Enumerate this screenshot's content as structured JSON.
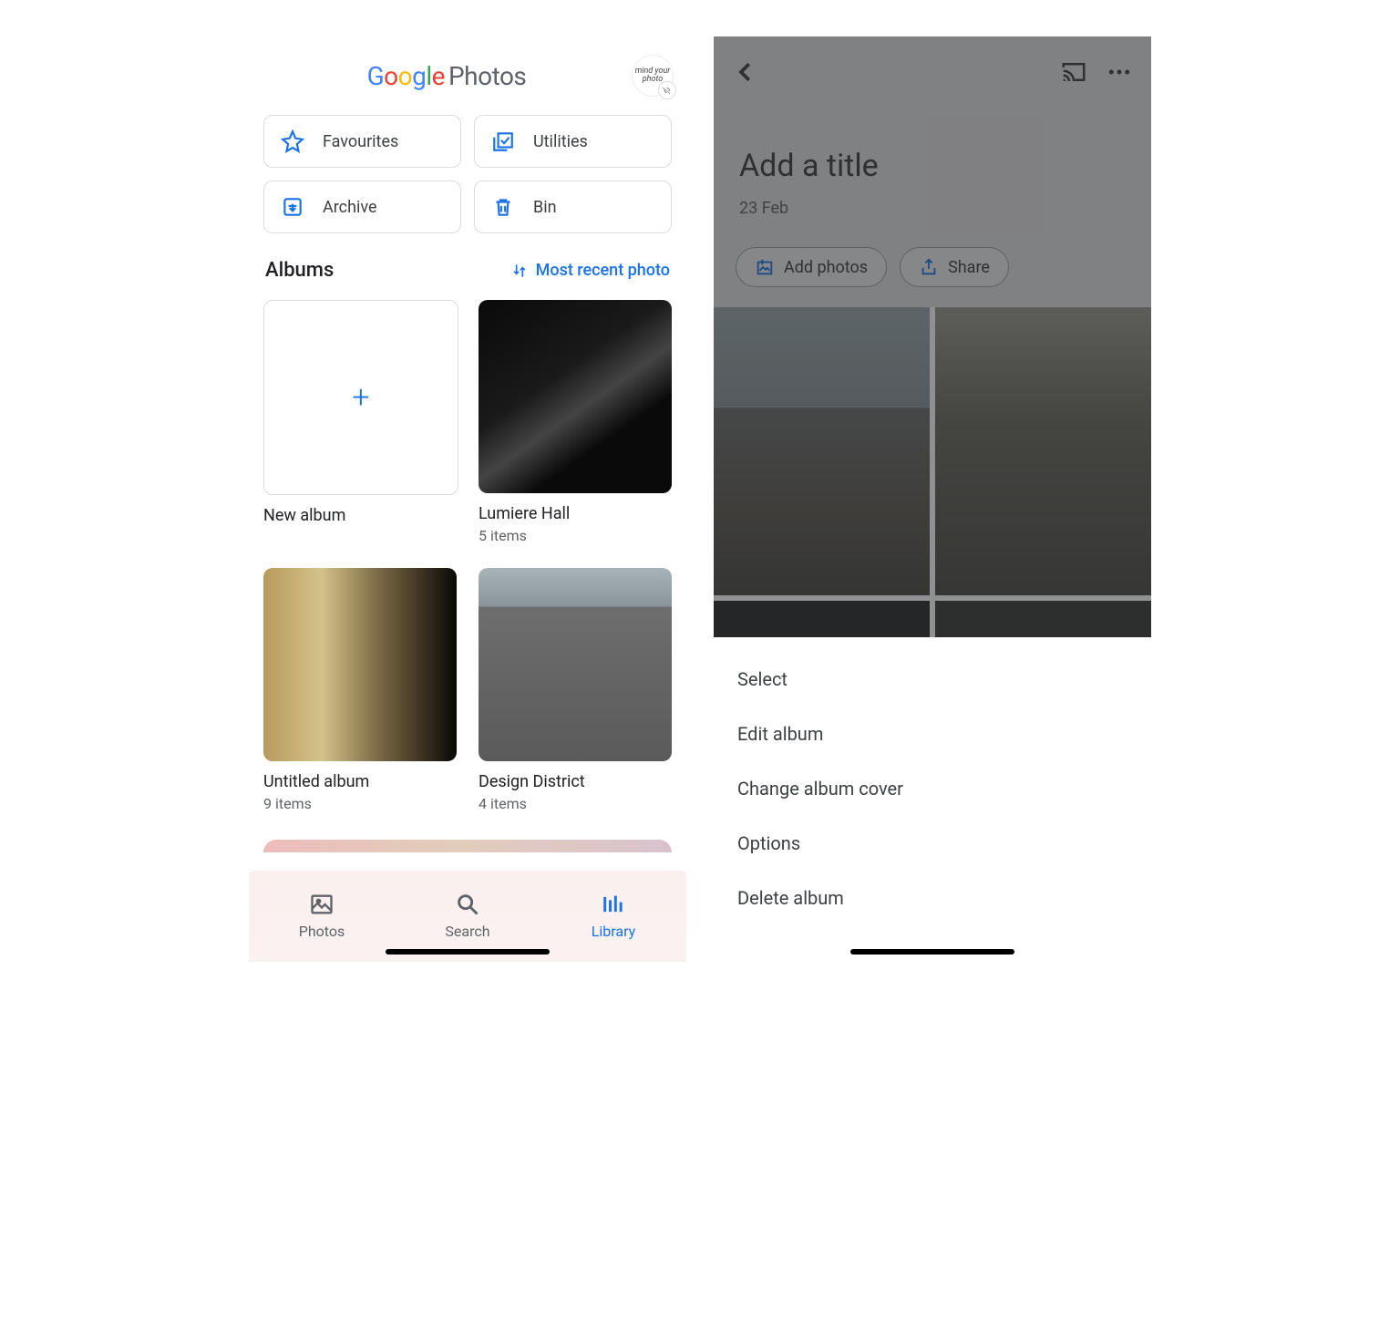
{
  "app_title": {
    "google": "Google",
    "photos_word": "Photos"
  },
  "avatar_text": "mind your photo",
  "chips": {
    "favourites": "Favourites",
    "utilities": "Utilities",
    "archive": "Archive",
    "bin": "Bin"
  },
  "section": {
    "title": "Albums",
    "sort_label": "Most recent photo"
  },
  "albums": [
    {
      "name": "New album"
    },
    {
      "name": "Lumiere Hall",
      "count": "5 items"
    },
    {
      "name": "Untitled album",
      "count": "9 items"
    },
    {
      "name": "Design District",
      "count": "4 items"
    }
  ],
  "nav": {
    "photos": "Photos",
    "search": "Search",
    "library": "Library"
  },
  "detail": {
    "title_placeholder": "Add a title",
    "date": "23 Feb",
    "add_photos": "Add photos",
    "share": "Share"
  },
  "menu": {
    "select": "Select",
    "edit": "Edit album",
    "cover": "Change album cover",
    "options": "Options",
    "delete": "Delete album"
  }
}
